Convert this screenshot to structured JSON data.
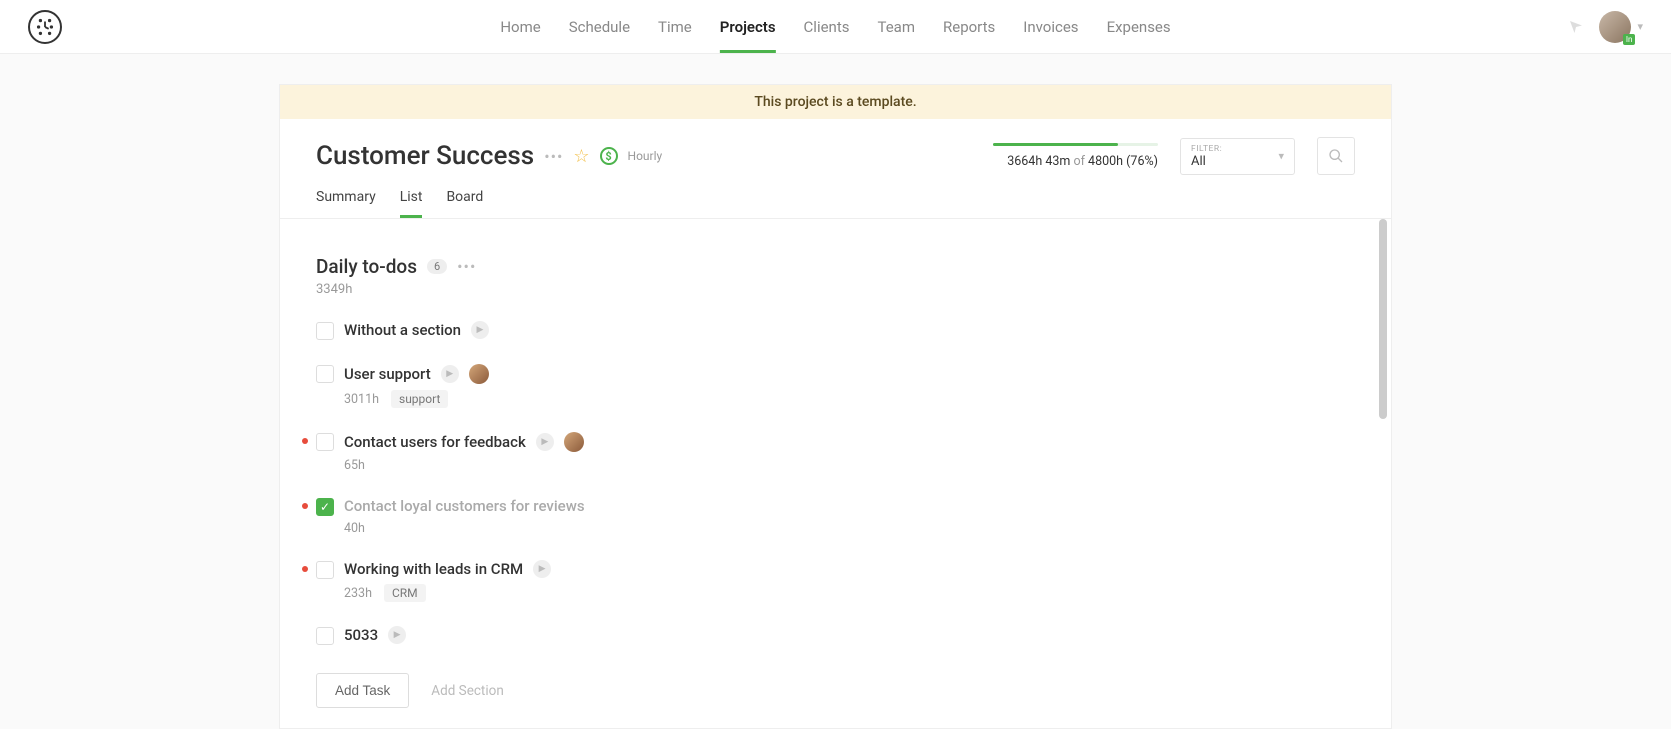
{
  "nav": {
    "items": [
      "Home",
      "Schedule",
      "Time",
      "Projects",
      "Clients",
      "Team",
      "Reports",
      "Invoices",
      "Expenses"
    ],
    "active_index": 3,
    "avatar_badge": "In"
  },
  "banner": "This project is a template.",
  "project": {
    "title": "Customer Success",
    "rate_type": "Hourly",
    "progress": {
      "used": "3664h 43m",
      "of_text": "of",
      "total": "4800h",
      "percent_label": "(76%)",
      "percent": 76
    },
    "filter": {
      "label": "FILTER:",
      "value": "All"
    },
    "tabs": [
      "Summary",
      "List",
      "Board"
    ],
    "active_tab_index": 1
  },
  "section": {
    "title": "Daily to-dos",
    "count": "6",
    "hours": "3349h"
  },
  "tasks": [
    {
      "title": "Without a section",
      "checked": false,
      "play": true,
      "priority": false
    },
    {
      "title": "User support",
      "checked": false,
      "play": true,
      "assignee": true,
      "hours": "3011h",
      "tag": "support",
      "priority": false
    },
    {
      "title": "Contact users for feedback",
      "checked": false,
      "play": true,
      "assignee": true,
      "hours": "65h",
      "priority": true
    },
    {
      "title": "Contact loyal customers for reviews",
      "checked": true,
      "hours": "40h",
      "priority": true
    },
    {
      "title": "Working with leads in CRM",
      "checked": false,
      "play": true,
      "hours": "233h",
      "tag": "CRM",
      "priority": true
    },
    {
      "title": "5033",
      "checked": false,
      "play": true,
      "priority": false
    }
  ],
  "footer": {
    "add_task": "Add Task",
    "add_section": "Add Section"
  }
}
